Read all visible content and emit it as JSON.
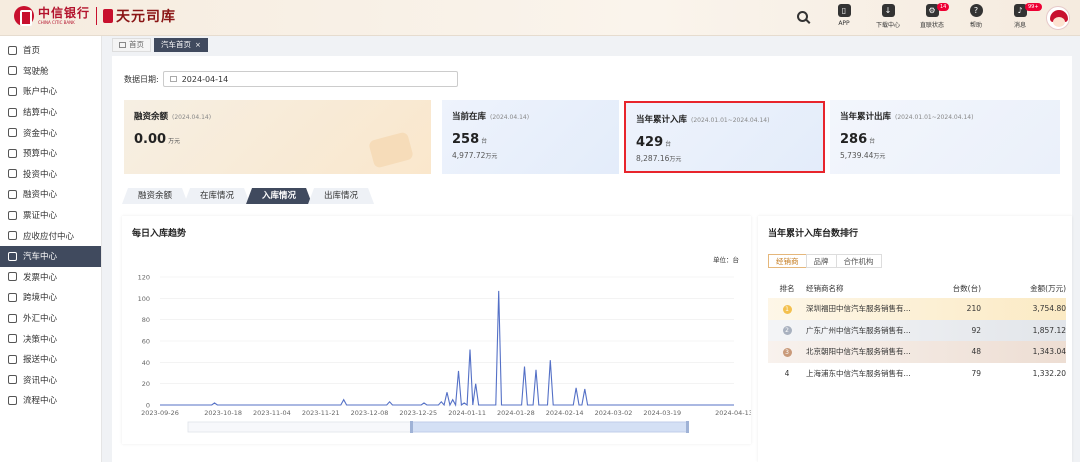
{
  "header": {
    "logo_cn": "中信银行",
    "logo_en": "CHINA CITIC BANK",
    "app_name": "天元司库",
    "icons": [
      {
        "name": "app-icon",
        "label": "APP",
        "badge": ""
      },
      {
        "name": "download-icon",
        "label": "下载中心",
        "badge": ""
      },
      {
        "name": "query-status-icon",
        "label": "直联状态",
        "badge": "14"
      },
      {
        "name": "help-icon",
        "label": "帮助",
        "badge": ""
      },
      {
        "name": "message-icon",
        "label": "消息",
        "badge": "99+"
      }
    ]
  },
  "sidebar": {
    "items": [
      {
        "label": "首页",
        "icon": "home-icon"
      },
      {
        "label": "驾驶舱",
        "icon": "dashboard-icon"
      },
      {
        "label": "账户中心",
        "icon": "account-icon"
      },
      {
        "label": "结算中心",
        "icon": "settlement-icon"
      },
      {
        "label": "资金中心",
        "icon": "fund-icon"
      },
      {
        "label": "预算中心",
        "icon": "budget-icon"
      },
      {
        "label": "投资中心",
        "icon": "invest-icon"
      },
      {
        "label": "融资中心",
        "icon": "finance-icon"
      },
      {
        "label": "票证中心",
        "icon": "bill-icon"
      },
      {
        "label": "应收应付中心",
        "icon": "receivable-icon"
      },
      {
        "label": "汽车中心",
        "icon": "car-icon"
      },
      {
        "label": "发票中心",
        "icon": "invoice-icon"
      },
      {
        "label": "跨境中心",
        "icon": "crossborder-icon"
      },
      {
        "label": "外汇中心",
        "icon": "fx-icon"
      },
      {
        "label": "决策中心",
        "icon": "decision-icon"
      },
      {
        "label": "报送中心",
        "icon": "report-icon"
      },
      {
        "label": "资讯中心",
        "icon": "news-icon"
      },
      {
        "label": "流程中心",
        "icon": "process-icon"
      }
    ],
    "active_index": 10
  },
  "tabs": {
    "home": "首页",
    "car_home": "汽车首页",
    "close": "×"
  },
  "filter": {
    "date_label": "数据日期:",
    "date_value": "2024-04-14"
  },
  "cards": [
    {
      "title": "融资余额",
      "period": "(2024.04.14)",
      "value": "0.00",
      "unit": "万元",
      "sub": "",
      "sub_unit": ""
    },
    {
      "title": "当前在库",
      "period": "(2024.04.14)",
      "value": "258",
      "unit": "台",
      "sub": "4,977.72",
      "sub_unit": "万元"
    },
    {
      "title": "当年累计入库",
      "period": "(2024.01.01~2024.04.14)",
      "value": "429",
      "unit": "台",
      "sub": "8,287.16",
      "sub_unit": "万元"
    },
    {
      "title": "当年累计出库",
      "period": "(2024.01.01~2024.04.14)",
      "value": "286",
      "unit": "台",
      "sub": "5,739.44",
      "sub_unit": "万元"
    }
  ],
  "subtabs": [
    "融资余额",
    "在库情况",
    "入库情况",
    "出库情况"
  ],
  "subtab_active": 2,
  "trend": {
    "title": "每日入库趋势",
    "unit": "单位：台"
  },
  "chart_data": {
    "type": "line",
    "title": "每日入库趋势",
    "xlabel": "",
    "ylabel": "",
    "ylim": [
      0,
      120
    ],
    "yticks": [
      0,
      20,
      40,
      60,
      80,
      100,
      120
    ],
    "xticks": [
      "2023-09-26",
      "2023-10-18",
      "2023-11-04",
      "2023-11-21",
      "2023-12-08",
      "2023-12-25",
      "2024-01-11",
      "2024-01-28",
      "2024-02-14",
      "2024-03-02",
      "2024-03-19",
      "2024-04-13"
    ],
    "grid": true,
    "series": [
      {
        "x": [
          "2023-09-26",
          "2023-10-14",
          "2023-10-15",
          "2023-10-16",
          "2023-11-28",
          "2023-11-29",
          "2023-11-30",
          "2023-12-14",
          "2023-12-15",
          "2023-12-16",
          "2023-12-26",
          "2023-12-27",
          "2023-12-28",
          "2024-01-01",
          "2024-01-02",
          "2024-01-03",
          "2024-01-04",
          "2024-01-05",
          "2024-01-06",
          "2024-01-07",
          "2024-01-08",
          "2024-01-09",
          "2024-01-10",
          "2024-01-11",
          "2024-01-12",
          "2024-01-13",
          "2024-01-14",
          "2024-01-15",
          "2024-01-16",
          "2024-01-17",
          "2024-01-18",
          "2024-01-20",
          "2024-01-21",
          "2024-01-22",
          "2024-01-23",
          "2024-01-24",
          "2024-01-25",
          "2024-01-26",
          "2024-01-30",
          "2024-01-31",
          "2024-02-01",
          "2024-02-03",
          "2024-02-04",
          "2024-02-05",
          "2024-02-08",
          "2024-02-09",
          "2024-02-10",
          "2024-02-17",
          "2024-02-18",
          "2024-02-19",
          "2024-02-20",
          "2024-02-21",
          "2024-02-22",
          "2024-02-23",
          "2024-04-13"
        ],
        "values": [
          0,
          0,
          2,
          0,
          0,
          5,
          0,
          0,
          3,
          0,
          0,
          2,
          0,
          0,
          3,
          0,
          12,
          0,
          5,
          0,
          32,
          0,
          2,
          0,
          52,
          0,
          20,
          0,
          0,
          0,
          0,
          0,
          0,
          107,
          0,
          0,
          0,
          0,
          0,
          36,
          0,
          0,
          33,
          0,
          0,
          42,
          0,
          0,
          16,
          0,
          0,
          15,
          0,
          0,
          0
        ]
      }
    ]
  },
  "ranking": {
    "title": "当年累计入库台数排行",
    "tabs": [
      "经销商",
      "品牌",
      "合作机构"
    ],
    "active_tab": 0,
    "columns": [
      "排名",
      "经销商名称",
      "台数(台)",
      "金额(万元)"
    ],
    "rows": [
      {
        "rank": "1",
        "name": "深圳福田中信汽车服务销售有...",
        "count": "210",
        "amount": "3,754.80",
        "color": "#f3c04e"
      },
      {
        "rank": "2",
        "name": "广东广州中信汽车服务销售有...",
        "count": "92",
        "amount": "1,857.12",
        "color": "#a8b1bf"
      },
      {
        "rank": "3",
        "name": "北京朝阳中信汽车服务销售有...",
        "count": "48",
        "amount": "1,343.04",
        "color": "#c99a7a"
      },
      {
        "rank": "4",
        "name": "上海浦东中信汽车服务销售有...",
        "count": "79",
        "amount": "1,332.20",
        "color": ""
      }
    ]
  }
}
